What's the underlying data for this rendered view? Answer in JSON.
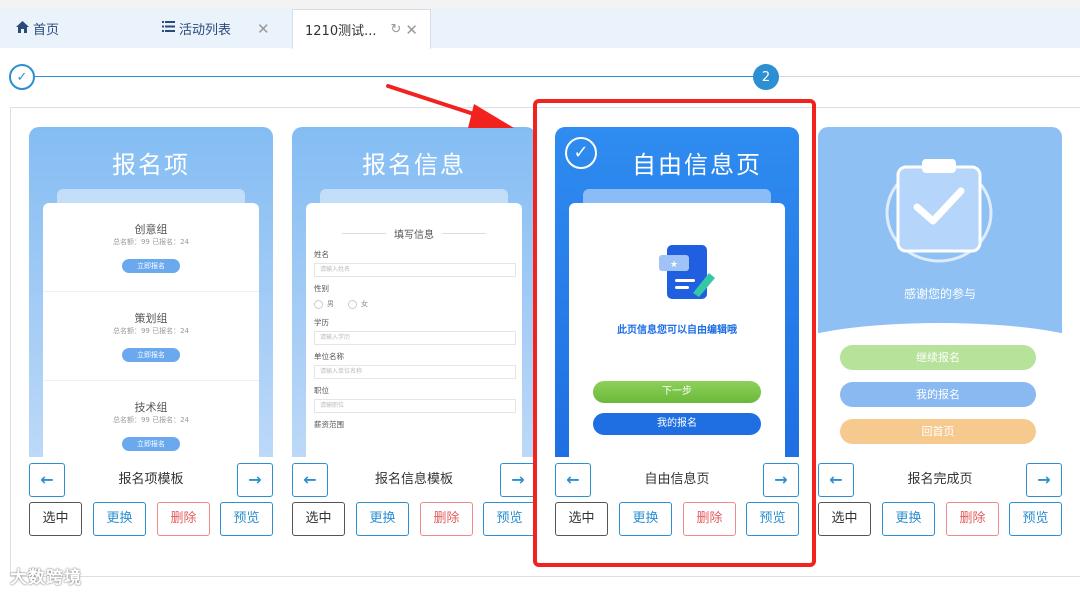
{
  "tabs": [
    {
      "label": "首页",
      "icon": "home-icon"
    },
    {
      "label": "活动列表",
      "icon": "list-icon",
      "close": "✕"
    },
    {
      "label": "1210测试...",
      "refresh": "↻",
      "close": "✕"
    }
  ],
  "steps": {
    "step1": "✓",
    "step2": "2"
  },
  "templates": [
    {
      "title": "报名项",
      "groups": [
        {
          "name": "创意组",
          "stats": "总名额：99   已报名：24",
          "button": "立即报名"
        },
        {
          "name": "策划组",
          "stats": "总名额：99   已报名：24",
          "button": "立即报名"
        },
        {
          "name": "技术组",
          "stats": "总名额：99   已报名：24",
          "button": "立即报名"
        }
      ],
      "name": "报名项模板"
    },
    {
      "title": "报名信息",
      "form_title": "填写信息",
      "fields": [
        {
          "label": "姓名",
          "placeholder": "请输入姓名"
        },
        {
          "label": "性别",
          "options": [
            "男",
            "女"
          ]
        },
        {
          "label": "学历",
          "placeholder": "请输入学历"
        },
        {
          "label": "单位名称",
          "placeholder": "请输入单位名称"
        },
        {
          "label": "职位",
          "placeholder": "请输职位"
        },
        {
          "label": "薪资范围"
        }
      ],
      "name": "报名信息模板"
    },
    {
      "title": "自由信息页",
      "check": "✓",
      "text": "此页信息您可以自由编辑哦",
      "next_button": "下一步",
      "my_button": "我的报名",
      "name": "自由信息页"
    },
    {
      "text": "感谢您的参与",
      "buttons": [
        "继续报名",
        "我的报名",
        "回首页"
      ],
      "button_colors": [
        "#b6e29a",
        "#8ab9f2",
        "#f6c98e"
      ],
      "name": "报名完成页"
    }
  ],
  "arrows": {
    "left": "←",
    "right": "→"
  },
  "actions": {
    "select": "选中",
    "replace": "更换",
    "delete": "删除",
    "preview": "预览"
  },
  "watermark": "大数跨境",
  "colors": {
    "accent": "#2b8fd1",
    "highlight": "#f2221e",
    "danger": "#e35d5d"
  }
}
